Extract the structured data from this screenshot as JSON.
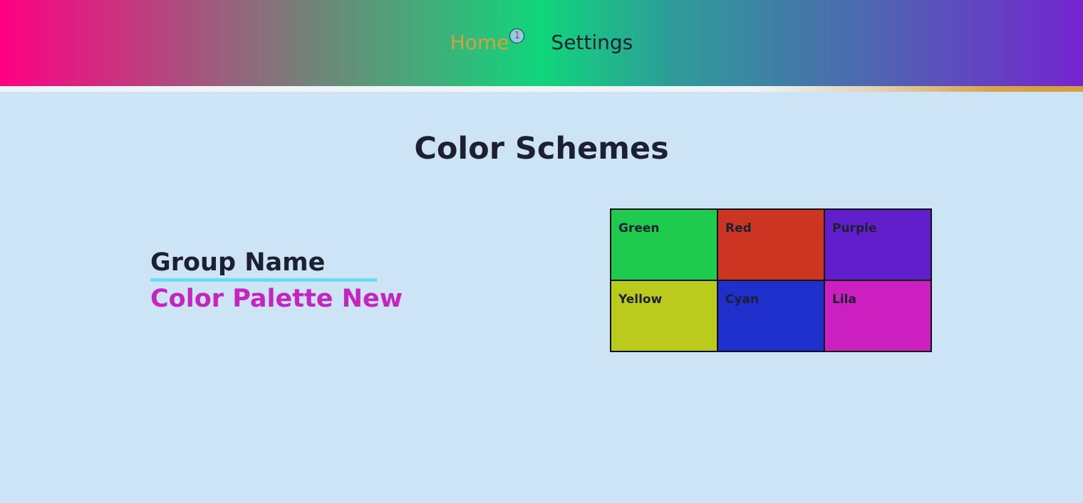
{
  "nav": {
    "home_label": "Home",
    "home_badge": "1",
    "settings_label": "Settings"
  },
  "page": {
    "title": "Color Schemes"
  },
  "group": {
    "label": "Group Name",
    "palette_name": "Color Palette New"
  },
  "swatches": [
    {
      "name": "Green",
      "color": "#1ecb4f"
    },
    {
      "name": "Red",
      "color": "#cb3522"
    },
    {
      "name": "Purple",
      "color": "#611fcb"
    },
    {
      "name": "Yellow",
      "color": "#bbcb1e"
    },
    {
      "name": "Cyan",
      "color": "#1f2fcb"
    },
    {
      "name": "Lila",
      "color": "#cb1fbf"
    }
  ]
}
